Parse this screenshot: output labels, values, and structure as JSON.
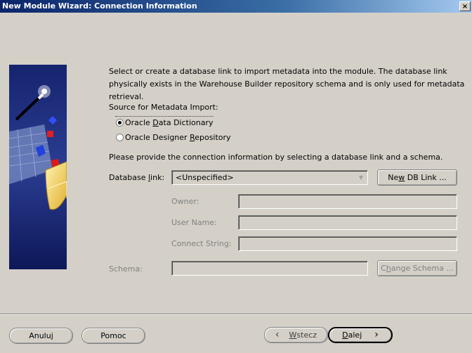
{
  "window": {
    "title": "New Module Wizard: Connection Information",
    "close_glyph": "×"
  },
  "intro": "Select or create a database link to import metadata into the module.  The database link physically exists in the Warehouse Builder repository schema and is only used for metadata retrieval.",
  "source_label": "Source for Metadata Import:",
  "sources": [
    {
      "pre": "Oracle ",
      "key": "D",
      "post": "ata Dictionary",
      "selected": true
    },
    {
      "pre": "Oracle Designer ",
      "key": "R",
      "post": "epository",
      "selected": false
    }
  ],
  "provide_text": "Please provide the connection information by selecting a database link and a schema.",
  "db_link": {
    "label_pre": "Database ",
    "label_key": "l",
    "label_post": "ink:",
    "value": "<Unspecified>",
    "button": {
      "pre": "Ne",
      "key": "w",
      "post": " DB Link ..."
    }
  },
  "owner_label": "Owner:",
  "user_name_label": "User Name:",
  "connect_string_label": "Connect String:",
  "schema": {
    "label": "Schema:",
    "value": "",
    "button": {
      "pre": "C",
      "key": "h",
      "post": "ange Schema ..."
    }
  },
  "footer": {
    "cancel": "Anuluj",
    "help": "Pomoc",
    "back": {
      "key": "W",
      "post": "stecz",
      "glyph": "‹"
    },
    "next": {
      "key": "D",
      "post": "alej",
      "glyph": "›"
    }
  }
}
